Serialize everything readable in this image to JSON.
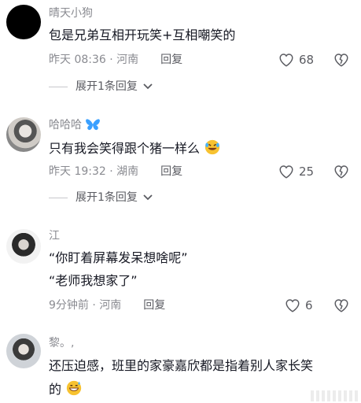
{
  "comments": [
    {
      "username": "晴天小狗",
      "text_lines": [
        "包是兄弟互相开玩笑+互相嘲笑的"
      ],
      "meta": "昨天 08:36 · 河南",
      "reply_label": "回复",
      "likes": "68",
      "expand_label": "展开1条回复",
      "avatar_icon": "avatar-black-circle"
    },
    {
      "username": "哈哈哈",
      "username_badge_icon": "butterfly-icon",
      "text_lines": [
        "只有我会笑得跟个猪一样么"
      ],
      "text_emoji_icon": "rofl-emoji-icon",
      "meta": "昨天 19:32 · 湖南",
      "reply_label": "回复",
      "likes": "25",
      "expand_label": "展开1条回复",
      "avatar_icon": "avatar-portrait"
    },
    {
      "username": "江",
      "text_lines": [
        "“你盯着屏幕发呆想啥呢”",
        "“老师我想家了”"
      ],
      "meta": "9分钟前 · 河南",
      "reply_label": "回复",
      "likes": "6",
      "avatar_icon": "avatar-portrait"
    },
    {
      "username": "黎。,",
      "text_lines": [
        "还压迫感，班里的家豪嘉欣都是指着别人家长笑",
        "的"
      ],
      "text_emoji_icon": "grin-sweat-emoji-icon",
      "avatar_icon": "avatar-portrait"
    }
  ],
  "icons": {
    "like": "heart-outline-icon",
    "dislike": "broken-heart-icon",
    "expand": "chevron-down-icon"
  },
  "colors": {
    "text": "#161823",
    "secondary": "#8a8b91",
    "badge": "#3aa0ff"
  }
}
